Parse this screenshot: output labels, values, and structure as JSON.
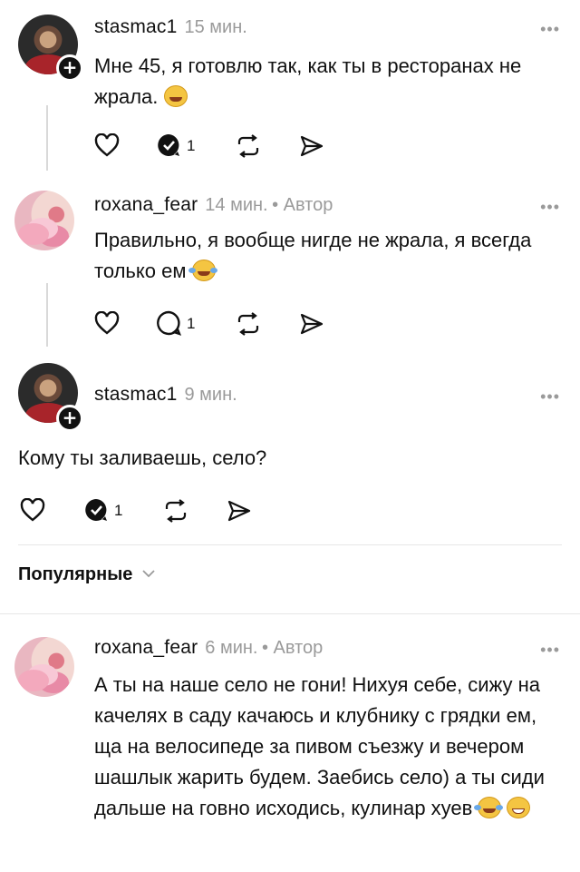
{
  "comments": [
    {
      "username": "stasmac1",
      "time": "15 мин.",
      "author_label": "",
      "text": "Мне 45, я готовлю так, как ты в ресторанах не жрала.",
      "reply_count": "1"
    },
    {
      "username": "roxana_fear",
      "time": "14 мин.",
      "author_label": "• Автор",
      "text": "Правильно, я вообще нигде не жрала, я всегда только ем",
      "reply_count": "1"
    },
    {
      "username": "stasmac1",
      "time": "9 мин.",
      "author_label": "",
      "text": "Кому ты заливаешь, село?",
      "reply_count": "1"
    },
    {
      "username": "roxana_fear",
      "time": "6 мин.",
      "author_label": "• Автор",
      "text": "А ты на наше село не гони! Нихуя себе, сижу на качелях в саду качаюсь и клубнику с грядки ем, ща на велосипеде за пивом съезжу и вечером шашлык жарить будем. Заебись село) а ты сиди дальше на говно исходись, кулинар хуев",
      "reply_count": ""
    }
  ],
  "sort": {
    "label": "Популярные"
  },
  "icons": {
    "more": "more-dots-icon",
    "like": "heart-icon",
    "reply": "comment-icon",
    "repost": "repost-icon",
    "share": "send-icon",
    "follow": "plus-icon",
    "chevron": "chevron-down-icon"
  }
}
